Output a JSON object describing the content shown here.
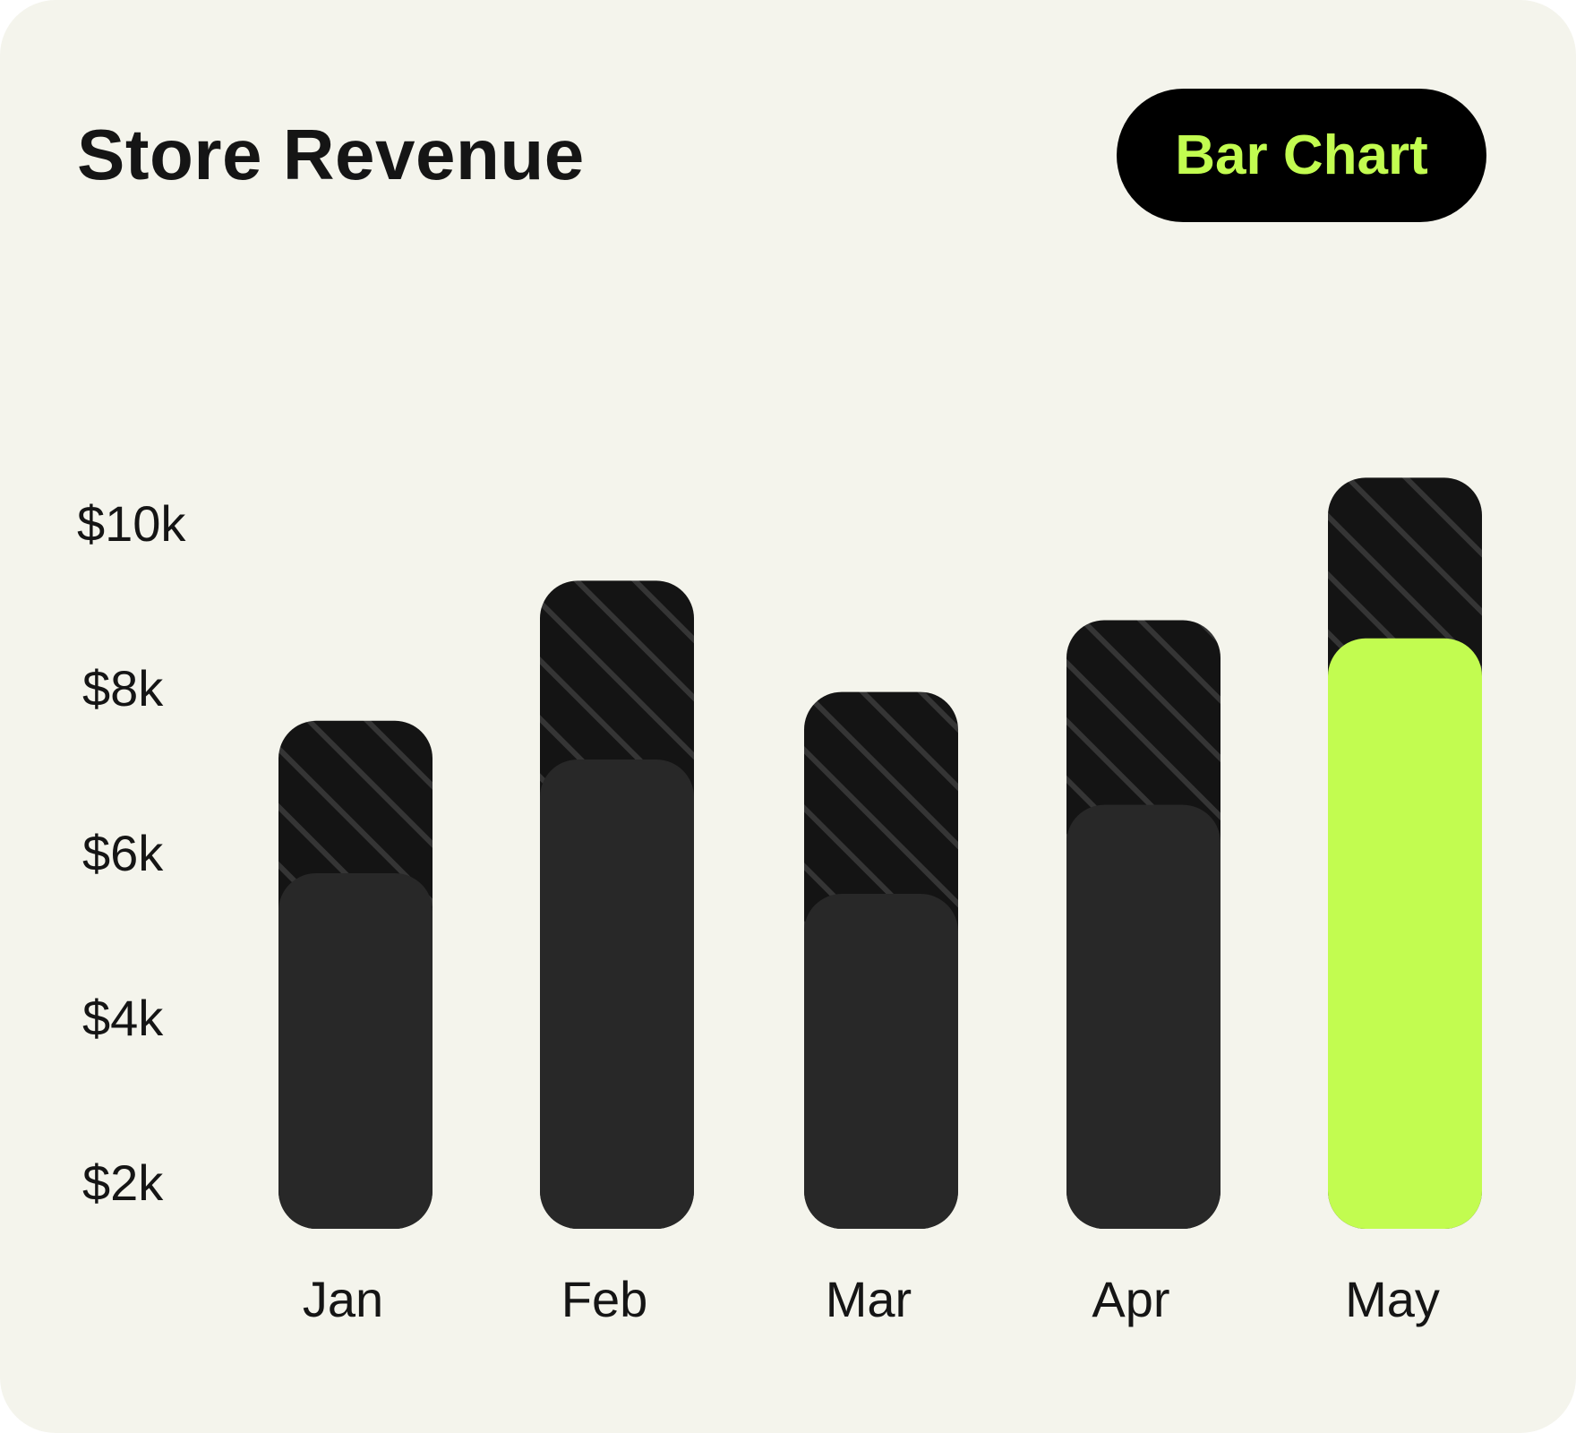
{
  "header": {
    "title": "Store Revenue",
    "badge_label": "Bar Chart"
  },
  "colors": {
    "background": "#f4f4ec",
    "bar_dark": "#282828",
    "bar_target": "#141414",
    "hatch": "#353535",
    "highlight": "#c2fc50",
    "badge_bg": "#000000"
  },
  "chart_data": {
    "type": "bar",
    "categories": [
      "Jan",
      "Feb",
      "Mar",
      "Apr",
      "May"
    ],
    "series": [
      {
        "values": [
          7600,
          9300,
          7950,
          8820,
          10550
        ]
      },
      {
        "values": [
          5750,
          7130,
          5500,
          6580,
          8600
        ]
      }
    ],
    "highlight_category": "May",
    "y_tick_labels": [
      "$10k",
      "$8k",
      "$6k",
      "$4k",
      "$2k"
    ],
    "y_tick_values": [
      10000,
      8000,
      6000,
      4000,
      2000
    ],
    "ylim": [
      0,
      10550
    ],
    "grid": false,
    "legend": "none"
  }
}
